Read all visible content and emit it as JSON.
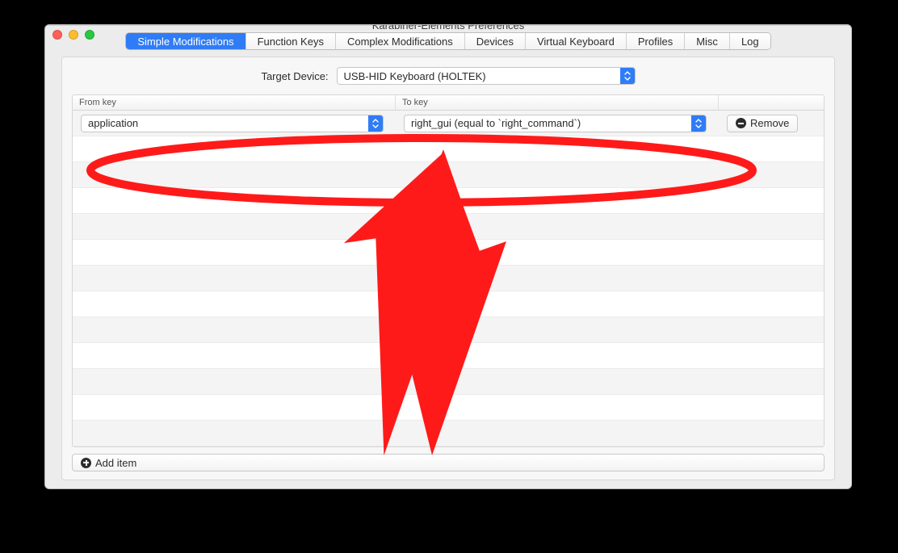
{
  "window": {
    "title": "Karabiner-Elements Preferences"
  },
  "tabs": [
    "Simple Modifications",
    "Function Keys",
    "Complex Modifications",
    "Devices",
    "Virtual Keyboard",
    "Profiles",
    "Misc",
    "Log"
  ],
  "active_tab_index": 0,
  "target_device": {
    "label": "Target Device:",
    "value": "USB-HID Keyboard (HOLTEK)"
  },
  "columns": {
    "from": "From key",
    "to": "To key"
  },
  "rows": [
    {
      "from": "application",
      "to": "right_gui (equal to `right_command`)"
    }
  ],
  "empty_row_count": 12,
  "buttons": {
    "remove": "Remove",
    "add_item": "Add item"
  }
}
